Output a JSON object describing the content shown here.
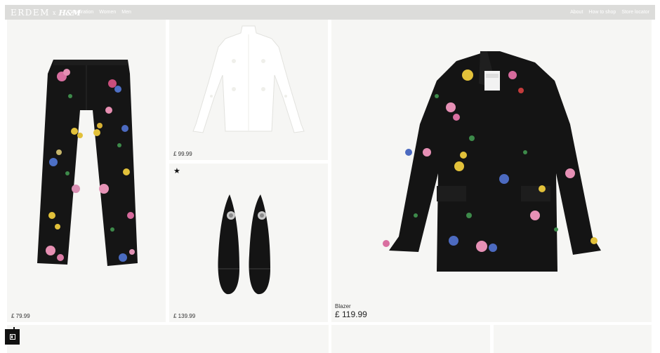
{
  "brand": {
    "name": "ERDEM",
    "separator": "x",
    "partner": "H&M"
  },
  "nav": {
    "left": [
      "Inspiration",
      "Women",
      "Men"
    ],
    "right": [
      "About",
      "How to shop",
      "Store locator"
    ]
  },
  "products": {
    "trousers": {
      "price": "£ 79.99"
    },
    "blouse": {
      "price": "£ 99.99"
    },
    "shoes": {
      "price": "£ 139.99",
      "badge_icon": "star-icon"
    },
    "blazer": {
      "name": "Blazer",
      "price": "£ 119.99"
    }
  },
  "colors": {
    "nav_bg": "#dcdcda",
    "tile_bg": "#f6f6f4",
    "garment_black": "#141414"
  }
}
